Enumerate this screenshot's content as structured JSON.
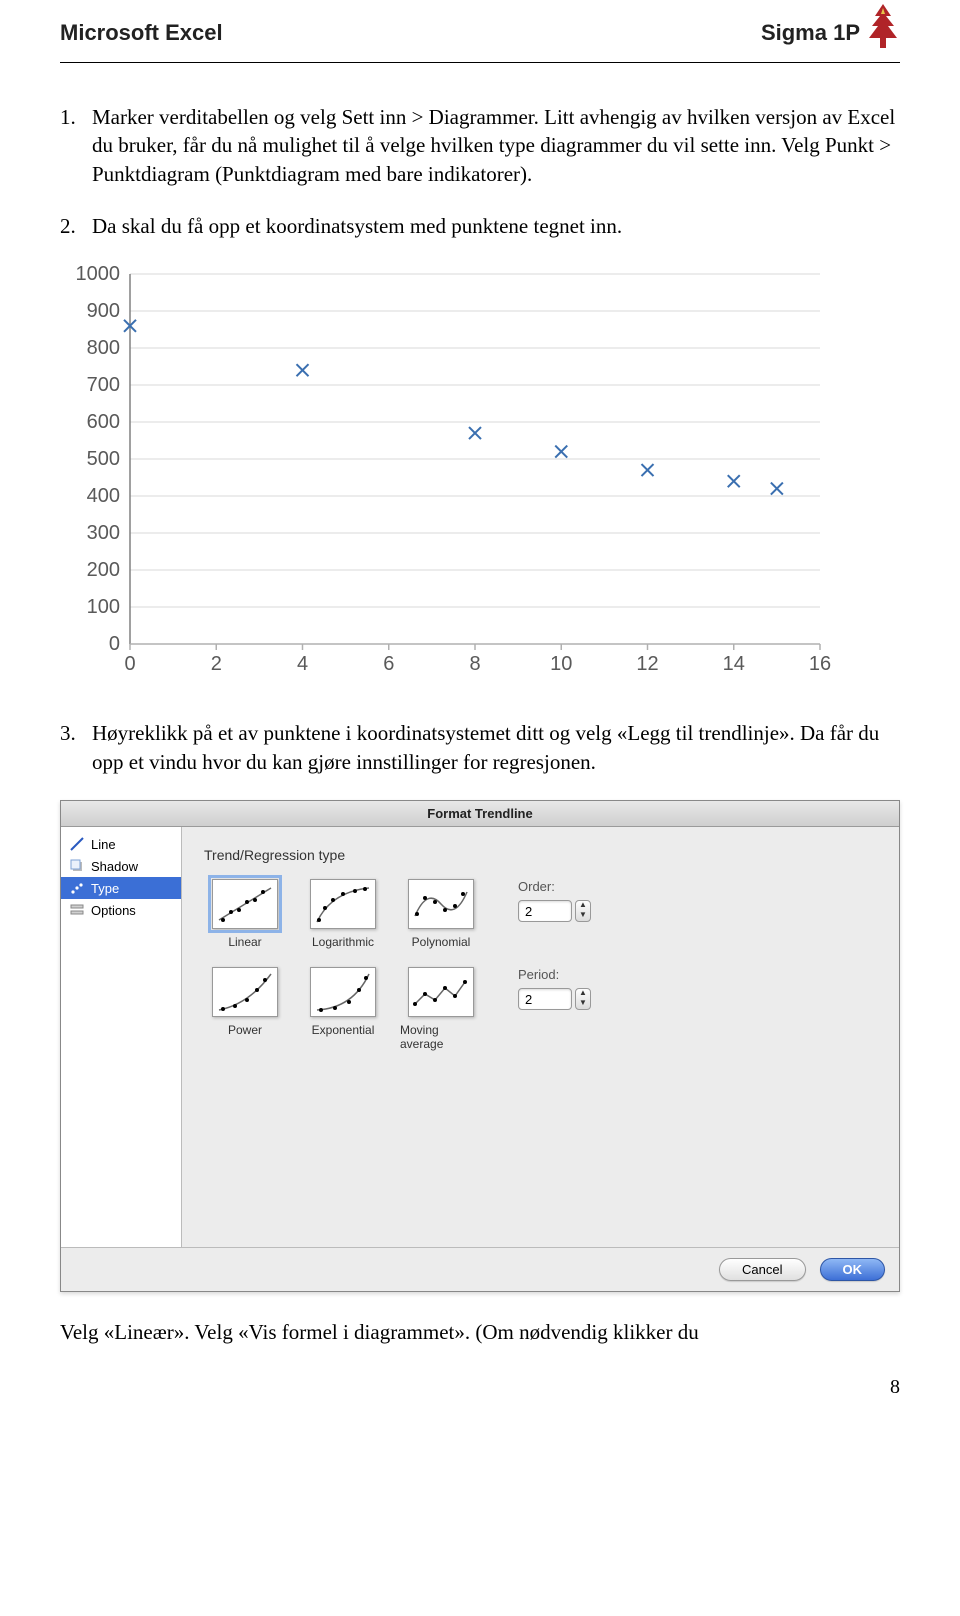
{
  "header": {
    "left": "Microsoft Excel",
    "right": "Sigma 1P"
  },
  "steps": {
    "one_num": "1.",
    "one_text": "Marker verditabellen og velg Sett inn > Diagrammer. Litt avhengig av hvilken versjon av Excel du bruker, får du nå mulighet til å velge hvilken type diagrammer du vil sette inn. Velg Punkt > Punktdiagram (Punktdiagram med bare indikatorer).",
    "two_num": "2.",
    "two_text": "Da skal du få opp et koordinatsystem med punktene tegnet inn.",
    "three_num": "3.",
    "three_text": "Høyreklikk på et av punktene i koordinatsystemet ditt og velg «Legg til trendlinje». Da får du opp et vindu hvor du kan gjøre innstillinger for regresjonen."
  },
  "footer_text": "Velg «Lineær». Velg «Vis formel i diagrammet». (Om nødvendig klikker du",
  "page_number": "8",
  "chart_data": {
    "type": "scatter",
    "x": [
      0,
      4,
      8,
      10,
      12,
      14,
      15
    ],
    "y": [
      860,
      740,
      570,
      520,
      470,
      440,
      420
    ],
    "xlim": [
      0,
      16
    ],
    "ylim": [
      0,
      1000
    ],
    "x_ticks": [
      0,
      2,
      4,
      6,
      8,
      10,
      12,
      14,
      16
    ],
    "y_ticks": [
      0,
      100,
      200,
      300,
      400,
      500,
      600,
      700,
      800,
      900,
      1000
    ]
  },
  "dialog": {
    "title": "Format Trendline",
    "sidebar": {
      "items": [
        {
          "label": "Line"
        },
        {
          "label": "Shadow"
        },
        {
          "label": "Type"
        },
        {
          "label": "Options"
        }
      ]
    },
    "group_label": "Trend/Regression type",
    "types_row1": [
      {
        "label": "Linear"
      },
      {
        "label": "Logarithmic"
      },
      {
        "label": "Polynomial"
      }
    ],
    "types_row2": [
      {
        "label": "Power"
      },
      {
        "label": "Exponential"
      },
      {
        "label": "Moving average"
      }
    ],
    "order_label": "Order:",
    "order_value": "2",
    "period_label": "Period:",
    "period_value": "2",
    "cancel": "Cancel",
    "ok": "OK"
  }
}
